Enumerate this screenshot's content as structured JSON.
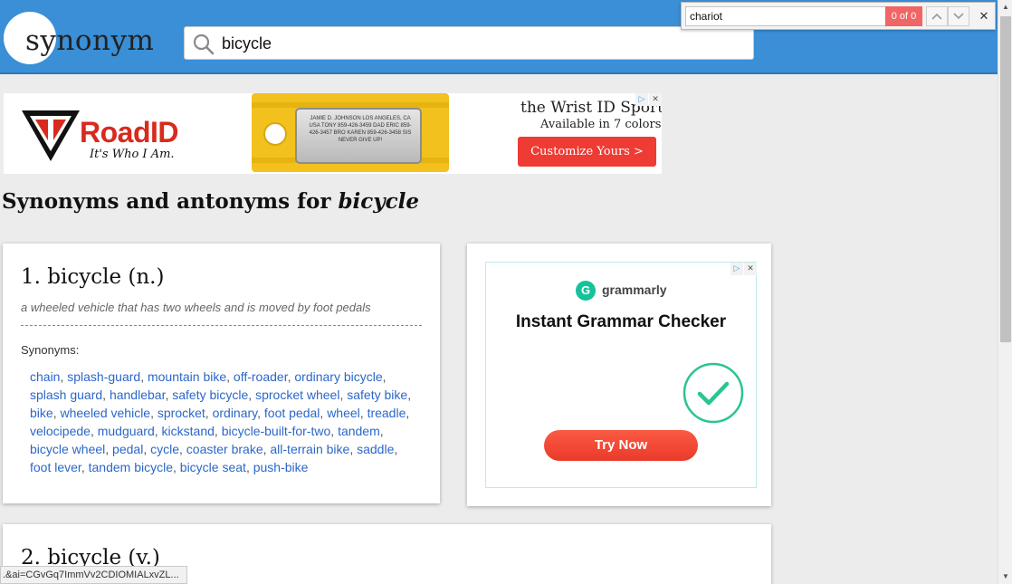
{
  "header": {
    "logo": "synonym",
    "search_value": "bicycle"
  },
  "findbar": {
    "query": "chariot",
    "count": "0 of 0",
    "prev_icon": "chevron-up-icon",
    "next_icon": "chevron-down-icon",
    "close": "✕"
  },
  "banner_ad": {
    "brand": "RoadID",
    "brand_part1": "Road",
    "brand_part2": "ID",
    "tagline": "It's Who I Am.",
    "headline": "the Wrist ID Sport",
    "subline": "Available in 7 colors",
    "cta": "Customize Yours >",
    "plate_text": "JAMIE D. JOHNSON LOS ANGELES, CA USA TONY 859-426-3459 DAD ERIC 859-426-3457 BRO KAREN 859-426-3458 SIS NEVER GIVE UP!"
  },
  "page": {
    "heading_prefix": "Synonyms and antonyms for ",
    "heading_word": "bicycle"
  },
  "results": [
    {
      "title": "1. bicycle (n.)",
      "definition": "a wheeled vehicle that has two wheels and is moved by foot pedals",
      "synonyms_label": "Synonyms:",
      "synonyms": [
        "chain",
        "splash-guard",
        "mountain bike",
        "off-roader",
        "ordinary bicycle",
        "splash guard",
        "handlebar",
        "safety bicycle",
        "sprocket wheel",
        "safety bike",
        "bike",
        "wheeled vehicle",
        "sprocket",
        "ordinary",
        "foot pedal",
        "wheel",
        "treadle",
        "velocipede",
        "mudguard",
        "kickstand",
        "bicycle-built-for-two",
        "tandem",
        "bicycle wheel",
        "pedal",
        "cycle",
        "coaster brake",
        "all-terrain bike",
        "saddle",
        "foot lever",
        "tandem bicycle",
        "bicycle seat",
        "push-bike"
      ]
    },
    {
      "title": "2. bicycle (v.)"
    }
  ],
  "side_ad": {
    "brand": "grammarly",
    "logo_letter": "G",
    "headline": "Instant Grammar Checker",
    "cta": "Try Now"
  },
  "status_bar": {
    "url": ".&ai=CGvGq7ImmVv2CDIOMIALxvZL..."
  },
  "colors": {
    "header_blue": "#3a8fd6",
    "link_blue": "#2b67c9",
    "find_nomatch": "#f06565",
    "cta_red": "#ee3b34",
    "grammarly_green": "#15c39a"
  }
}
